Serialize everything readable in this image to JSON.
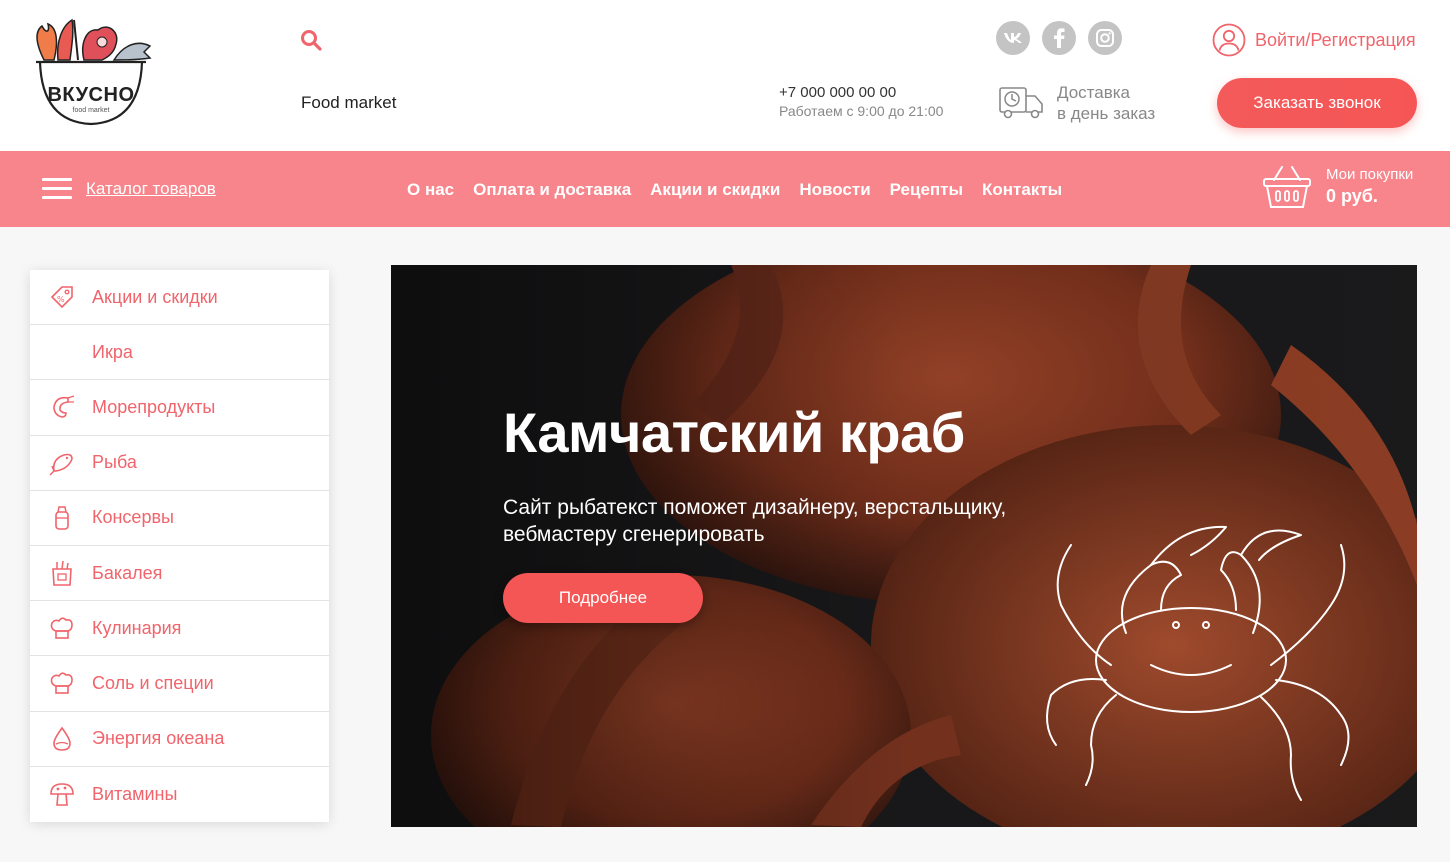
{
  "brand": {
    "logo_text": "ВКУСНО",
    "logo_sub": "food market",
    "site_name": "Food market"
  },
  "header": {
    "phone": "+7 000 000 00 00",
    "hours": "Работаем с 9:00 до 21:00",
    "delivery_line1": "Доставка",
    "delivery_line2": "в день заказ",
    "login_label": "Войти/Регистрация",
    "call_button": "Заказать звонок",
    "socials": [
      "vk-icon",
      "facebook-icon",
      "instagram-icon"
    ]
  },
  "nav": {
    "catalog_label": "Каталог товаров",
    "menu": [
      "О нас",
      "Оплата и доставка",
      "Акции и скидки",
      "Новости",
      "Рецепты",
      "Контакты"
    ],
    "cart_label": "Мои покупки",
    "cart_sum": "0 руб."
  },
  "sidebar": {
    "items": [
      {
        "label": "Акции и скидки",
        "icon": "discount-tag-icon"
      },
      {
        "label": "Икра",
        "icon": ""
      },
      {
        "label": "Морепродукты",
        "icon": "shrimp-icon"
      },
      {
        "label": "Рыба",
        "icon": "fish-icon"
      },
      {
        "label": "Консервы",
        "icon": "can-icon"
      },
      {
        "label": "Бакалея",
        "icon": "grocery-bag-icon"
      },
      {
        "label": "Кулинария",
        "icon": "chef-hat-icon"
      },
      {
        "label": "Соль и специи",
        "icon": "chef-hat-icon"
      },
      {
        "label": "Энергия океана",
        "icon": "drop-icon"
      },
      {
        "label": "Витамины",
        "icon": "mushroom-icon"
      }
    ]
  },
  "hero": {
    "title": "Камчатский краб",
    "subtitle": "Сайт рыбатекст поможет дизайнеру, верстальщику, вебмастеру сгенерировать",
    "button": "Подробнее"
  },
  "colors": {
    "accent": "#f0646b",
    "nav_bg": "#f7858b",
    "button": "#f45555"
  }
}
